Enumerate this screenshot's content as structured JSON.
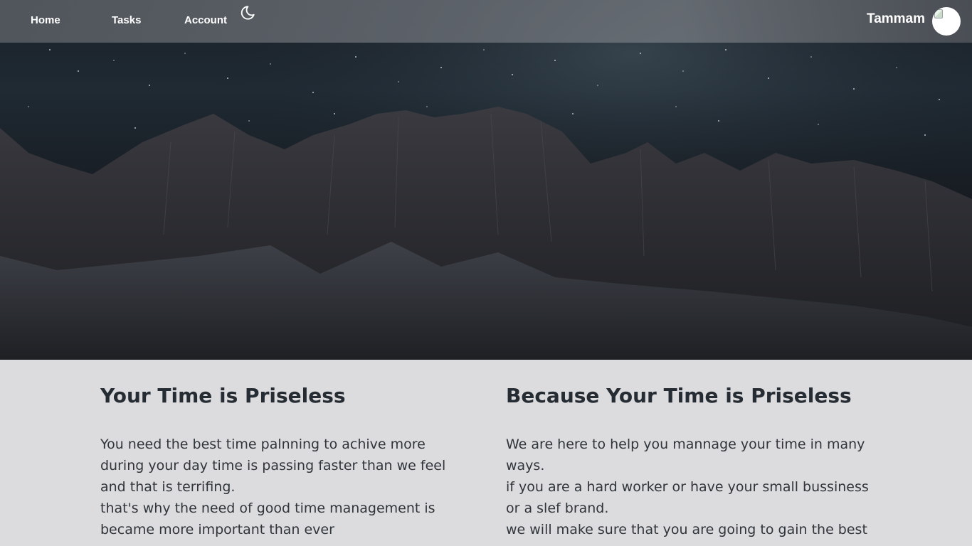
{
  "nav": {
    "home": "Home",
    "tasks": "Tasks",
    "account": "Account",
    "theme_icon": "moon-icon"
  },
  "user": {
    "name": "Tammam",
    "avatar_icon": "broken-image-icon"
  },
  "hero": {
    "image": "night-mountains-starry-sky"
  },
  "sections": {
    "left": {
      "title": "Your Time is Priseless",
      "lines": [
        "You need the best time palnning to achive more during your day time is passing faster than we feel and that is terrifing.",
        "that's why the need of good time management is became more important than ever"
      ]
    },
    "right": {
      "title": "Because Your Time is Priseless",
      "lines": [
        "We are here to help you mannage your time in many ways.",
        "if you are a hard worker or have your small bussiness or a slef brand.",
        "we will make sure that you are going to gain the best"
      ]
    }
  },
  "colors": {
    "content_bg": "#dcdbdd",
    "heading": "#262c33",
    "nav_text": "#ffffff"
  }
}
